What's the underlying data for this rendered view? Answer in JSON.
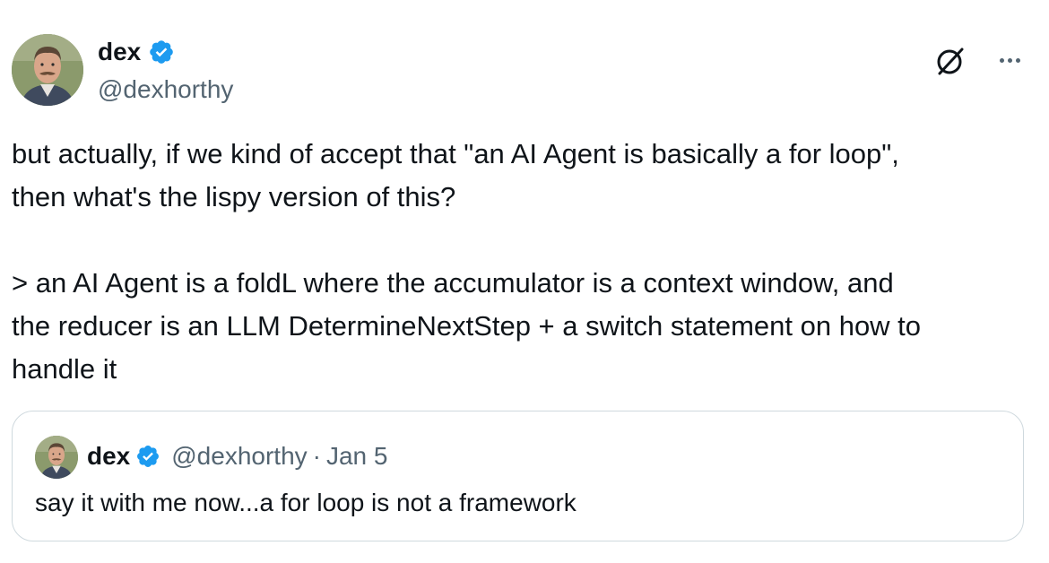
{
  "author": {
    "display_name": "dex",
    "handle": "@dexhorthy",
    "verified": true
  },
  "icons": {
    "avatar": "profile-photo",
    "verified": "verified-badge-icon",
    "grok": "grok-icon",
    "more": "more-options-icon"
  },
  "colors": {
    "text": "#0f1419",
    "secondary_text": "#536471",
    "verified_blue": "#1d9bf0",
    "card_border": "#cfd9de"
  },
  "tweet": {
    "paragraph_1": "but actually, if we kind of accept that \"an AI Agent is basically a for loop\",\nthen what's the lispy version of this?",
    "paragraph_2": "> an AI Agent is a foldL where the accumulator is a context window, and\nthe reducer is an LLM DetermineNextStep + a switch statement on how to\nhandle it"
  },
  "quoted_tweet": {
    "display_name": "dex",
    "handle": "@dexhorthy",
    "separator": "·",
    "date": "Jan 5",
    "text": "say it with me now...a for loop is not a framework"
  }
}
